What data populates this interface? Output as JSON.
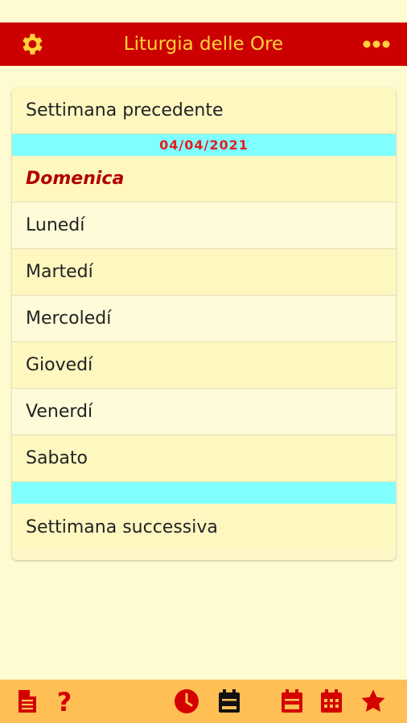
{
  "header": {
    "title": "Liturgia delle Ore",
    "left_icon": "gear-icon",
    "right_icon": "more-dots-icon"
  },
  "week": {
    "prev_label": "Settimana precedente",
    "date": "04/04/2021",
    "days": [
      "Domenica",
      "Lunedí",
      "Martedí",
      "Mercoledí",
      "Giovedí",
      "Venerdí",
      "Sabato"
    ],
    "next_label": "Settimana successiva"
  },
  "bottom_bar": {
    "icons": [
      "document-icon",
      "help-icon",
      "clock-icon",
      "calendar-day-icon",
      "calendar-week-icon",
      "calendar-month-icon",
      "star-icon"
    ]
  },
  "colors": {
    "header_bg": "#cc0000",
    "header_text": "#ffd23c",
    "page_bg": "#fffbd0",
    "highlight_bar": "#80ffff",
    "date_text": "#e21f1f",
    "bottom_bar": "#ffbf55",
    "icon_red": "#d40000"
  }
}
